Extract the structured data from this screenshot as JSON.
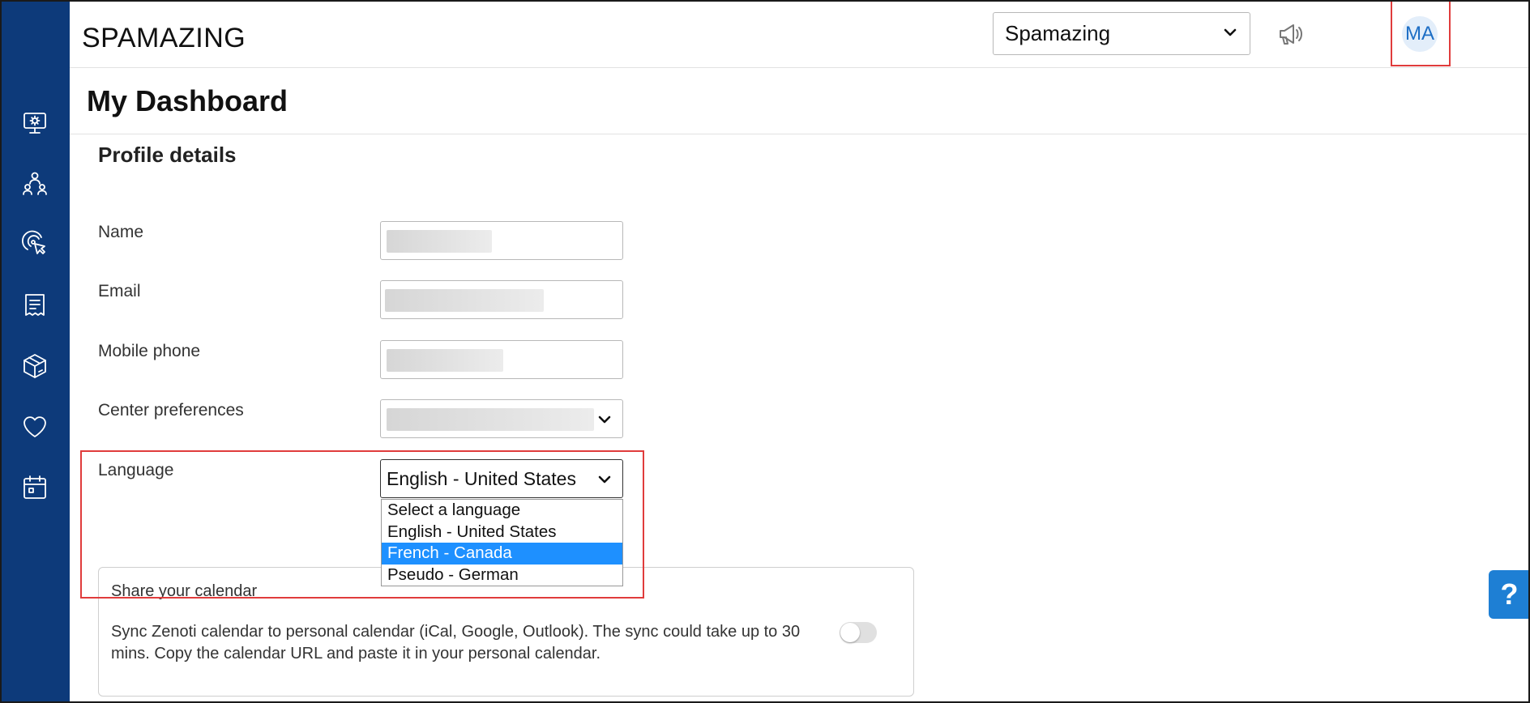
{
  "header": {
    "brand": "SPAMAZING",
    "org_selector_value": "Spamazing",
    "avatar_initials": "MA"
  },
  "page": {
    "title": "My Dashboard",
    "section_title": "Profile details"
  },
  "form": {
    "name_label": "Name",
    "email_label": "Email",
    "mobile_label": "Mobile phone",
    "center_label": "Center preferences",
    "language_label": "Language",
    "language_value": "English - United States",
    "language_options": [
      "Select a language",
      "English - United States",
      "French - Canada",
      "Pseudo - German"
    ],
    "language_highlighted_index": 2
  },
  "calendar": {
    "title": "Share your calendar",
    "description": "Sync Zenoti calendar to personal calendar (iCal, Google, Outlook). The sync could take up to 30 mins. Copy the calendar URL and paste it in your personal calendar.",
    "sync_enabled": false
  },
  "help": {
    "label": "?"
  },
  "sidebar": {
    "icons": [
      "dashboard-settings-icon",
      "team-icon",
      "marketing-touch-icon",
      "invoice-icon",
      "inventory-box-icon",
      "loyalty-heart-icon",
      "calendar-icon"
    ]
  },
  "colors": {
    "sidebar": "#0d3a7a",
    "highlight_border": "#e03c3c",
    "dropdown_selected": "#1e90ff",
    "help_button": "#1e7fd4"
  }
}
